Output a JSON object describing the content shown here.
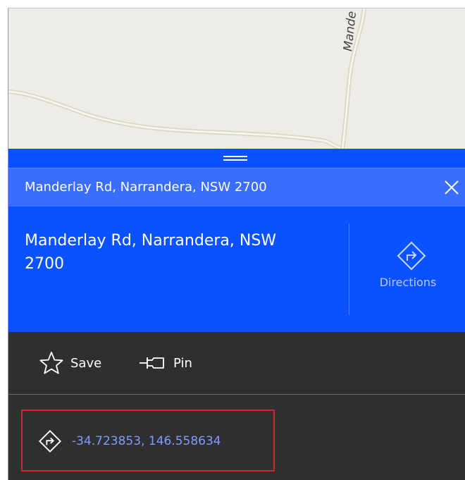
{
  "map": {
    "road_label": "Mande"
  },
  "panel": {
    "search_text": "Manderlay Rd, Narrandera, NSW 2700",
    "place_title": "Manderlay Rd, Narrandera, NSW 2700",
    "directions_label": "Directions",
    "actions": {
      "save_label": "Save",
      "pin_label": "Pin"
    },
    "coordinates": "-34.723853, 146.558634"
  },
  "icons": {
    "close": "close-icon",
    "directions": "directions-icon",
    "save": "star-icon",
    "pin": "pin-icon",
    "coordinates": "directions-icon"
  },
  "colors": {
    "accent_blue": "#0a52ff",
    "search_bar_blue": "#3b6eff",
    "dark_panel": "#2f2f2f",
    "link_blue": "#7f9cff",
    "highlight_red": "#d0252b",
    "map_background": "#eeece7"
  }
}
